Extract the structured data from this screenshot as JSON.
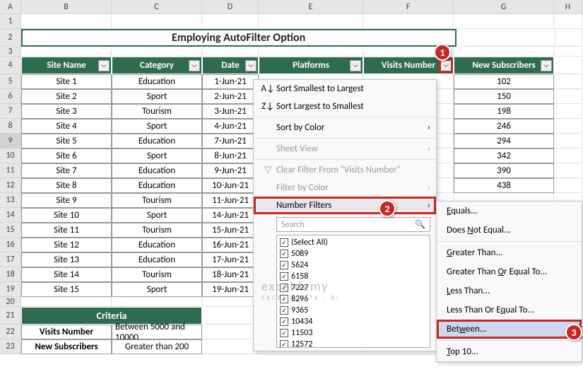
{
  "columns": [
    "A",
    "B",
    "C",
    "D",
    "E",
    "F",
    "G",
    "H"
  ],
  "title": "Employing AutoFilter Option",
  "headers": [
    "Site Name",
    "Category",
    "Date",
    "Platforms",
    "Visits Number",
    "New Subscribers"
  ],
  "rows": [
    {
      "site": "Site 1",
      "cat": "Education",
      "date": "1-Jun-21",
      "sub": "102"
    },
    {
      "site": "Site 2",
      "cat": "Sport",
      "date": "2-Jun-21",
      "sub": "150"
    },
    {
      "site": "Site 3",
      "cat": "Tourism",
      "date": "3-Jun-21",
      "sub": "198"
    },
    {
      "site": "Site 4",
      "cat": "Sport",
      "date": "4-Jun-21",
      "sub": "246"
    },
    {
      "site": "Site 5",
      "cat": "Education",
      "date": "7-Jun-21",
      "sub": "294"
    },
    {
      "site": "Site 6",
      "cat": "Sport",
      "date": "8-Jun-21",
      "sub": "342"
    },
    {
      "site": "Site 7",
      "cat": "Education",
      "date": "9-Jun-21",
      "sub": "390"
    },
    {
      "site": "Site 8",
      "cat": "Education",
      "date": "10-Jun-21",
      "sub": "438"
    },
    {
      "site": "Site 9",
      "cat": "Tourism",
      "date": "11-Jun-21",
      "sub": ""
    },
    {
      "site": "Site 10",
      "cat": "Sport",
      "date": "14-Jun-21",
      "sub": ""
    },
    {
      "site": "Site 11",
      "cat": "Tourism",
      "date": "15-Jun-21",
      "sub": ""
    },
    {
      "site": "Site 12",
      "cat": "Education",
      "date": "16-Jun-21",
      "sub": ""
    },
    {
      "site": "Site 13",
      "cat": "Education",
      "date": "17-Jun-21",
      "sub": ""
    },
    {
      "site": "Site 14",
      "cat": "Tourism",
      "date": "18-Jun-21",
      "sub": ""
    },
    {
      "site": "Site 15",
      "cat": "Sport",
      "date": "19-Jun-21",
      "sub": ""
    }
  ],
  "criteria": {
    "title": "Criteria",
    "r1_label": "Visits Number",
    "r1_val": "Between 5000 and 10000",
    "r2_label": "New Subscribers",
    "r2_val": "Greater than 200"
  },
  "menu": {
    "sort_asc": "Sort Smallest to Largest",
    "sort_desc": "Sort Largest to Smallest",
    "sort_color": "Sort by Color",
    "sheet_view": "Sheet View",
    "clear_filter": "Clear Filter From \"Visits Number\"",
    "filter_color": "Filter by Color",
    "number_filters": "Number Filters",
    "search_placeholder": "Search",
    "items": [
      "(Select All)",
      "5089",
      "5624",
      "6158",
      "7227",
      "8296",
      "9365",
      "10434",
      "11503",
      "12572"
    ]
  },
  "submenu": {
    "equals": "Equals...",
    "not_equal": "Does Not Equal...",
    "greater": "Greater Than...",
    "greater_eq": "Greater Than Or Equal To...",
    "less": "Less Than...",
    "less_eq": "Less Than Or Equal To...",
    "between": "Between...",
    "top10": "Top 10..."
  },
  "watermark": {
    "main": "exceldemy",
    "sub": "EXCEL · DATA · BI"
  },
  "callouts": {
    "c1": "1",
    "c2": "2",
    "c3": "3"
  }
}
